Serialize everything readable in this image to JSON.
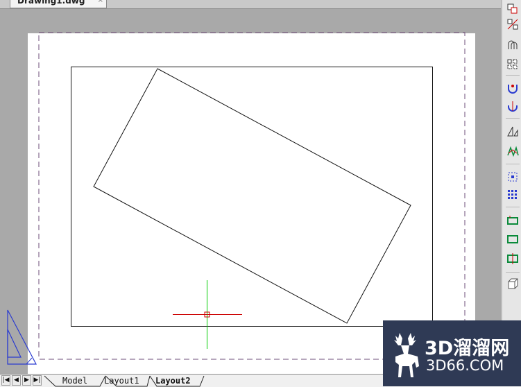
{
  "document": {
    "tab_label": "Drawing1.dwg",
    "close_glyph": "×"
  },
  "layout_tabs": {
    "items": [
      {
        "label": "Model",
        "active": false
      },
      {
        "label": "Layout1",
        "active": false
      },
      {
        "label": "Layout2",
        "active": true
      }
    ],
    "nav": [
      "|◀",
      "◀",
      "▶",
      "▶|"
    ]
  },
  "toolbar": {
    "tools": [
      "copy-object-icon",
      "mirror-icon",
      "offset-icon",
      "array-icon",
      "move-icon",
      "rotate-icon",
      "scale-icon",
      "stretch-icon",
      "trim-icon",
      "extend-icon",
      "break-icon",
      "chamfer-icon",
      "fillet-icon",
      "explode-icon"
    ]
  },
  "colors": {
    "crosshair_horizontal": "#cc0000",
    "crosshair_vertical": "#00cc00",
    "margin_dash": "#6e4c78",
    "ucs_icon": "#2a3bd0",
    "watermark_bg": "#2f3a55"
  },
  "watermark": {
    "brand": "3D溜溜网",
    "url": "3D66.COM"
  }
}
